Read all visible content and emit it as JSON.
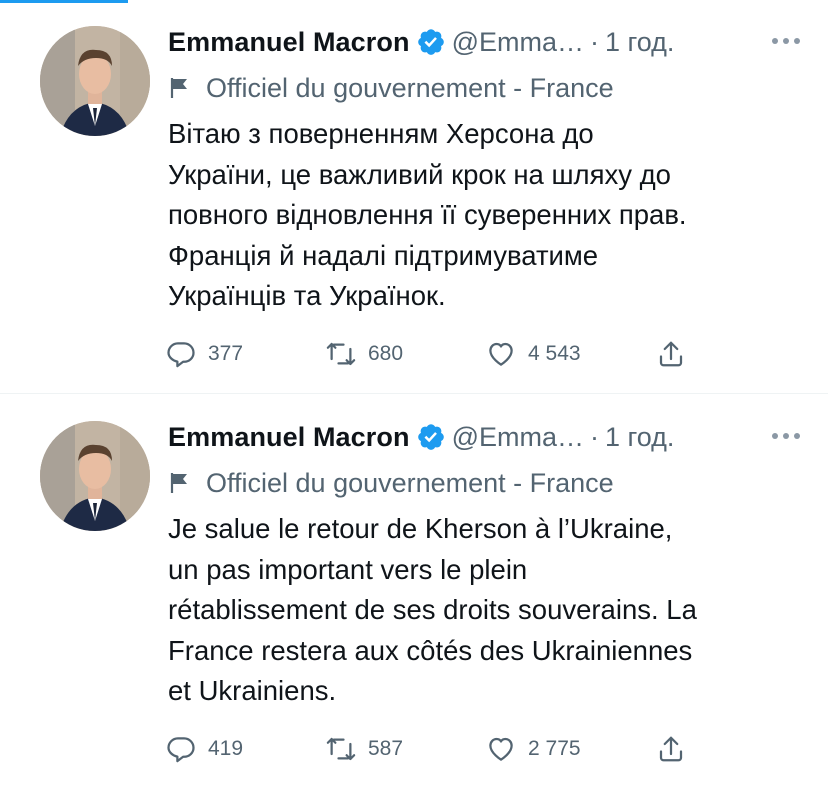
{
  "tweets": [
    {
      "author_name": "Emmanuel Macron",
      "handle": "@Emma…",
      "separator": "·",
      "time": "1 год.",
      "account_label": "Officiel du gouvernement - France",
      "text_lines": [
        "Вітаю з поверненням Херсона до",
        "України, це важливий крок на шляху до",
        "повного відновлення її суверенних прав.",
        "Франція й надалі підтримуватиме",
        "Українців та Українок."
      ],
      "replies": "377",
      "retweets": "680",
      "likes": "4 543"
    },
    {
      "author_name": "Emmanuel Macron",
      "handle": "@Emma…",
      "separator": "·",
      "time": "1 год.",
      "account_label": "Officiel du gouvernement - France",
      "text_lines": [
        "Je salue le retour de Kherson à l’Ukraine,",
        "un pas important vers le plein",
        "rétablissement de ses droits souverains. La",
        "France restera aux côtés des Ukrainiennes",
        "et Ukrainiens."
      ],
      "replies": "419",
      "retweets": "587",
      "likes": "2 775"
    }
  ],
  "icons": {
    "verified": "verified-badge-icon",
    "flag": "government-flag-icon",
    "more": "more-options-icon",
    "reply": "reply-icon",
    "retweet": "retweet-icon",
    "like": "heart-icon",
    "share": "share-icon"
  },
  "colors": {
    "accent": "#1d9bf0",
    "text_primary": "#0f1419",
    "text_secondary": "#536471",
    "divider": "#eff3f4"
  }
}
